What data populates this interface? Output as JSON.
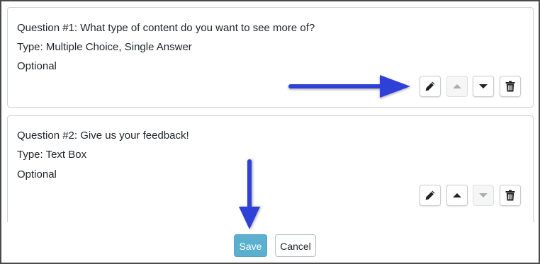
{
  "questions": [
    {
      "title": "Question #1: What type of content do you want to see more of?",
      "type": "Type: Multiple Choice, Single Answer",
      "required": "Optional",
      "actions": {
        "edit": "pencil-icon",
        "move_up": "caret-up-icon",
        "move_up_enabled": false,
        "move_down": "caret-down-icon",
        "move_down_enabled": true,
        "delete": "trash-icon"
      }
    },
    {
      "title": "Question #2: Give us your feedback!",
      "type": "Type: Text Box",
      "required": "Optional",
      "actions": {
        "edit": "pencil-icon",
        "move_up": "caret-up-icon",
        "move_up_enabled": true,
        "move_down": "caret-down-icon",
        "move_down_enabled": false,
        "delete": "trash-icon"
      }
    }
  ],
  "footer": {
    "save_label": "Save",
    "cancel_label": "Cancel"
  },
  "colors": {
    "annotation_arrow": "#2f3fd8",
    "save_button": "#5bb0cf",
    "card_border": "#cfd4d9",
    "frame_border": "#4a4a4a"
  }
}
